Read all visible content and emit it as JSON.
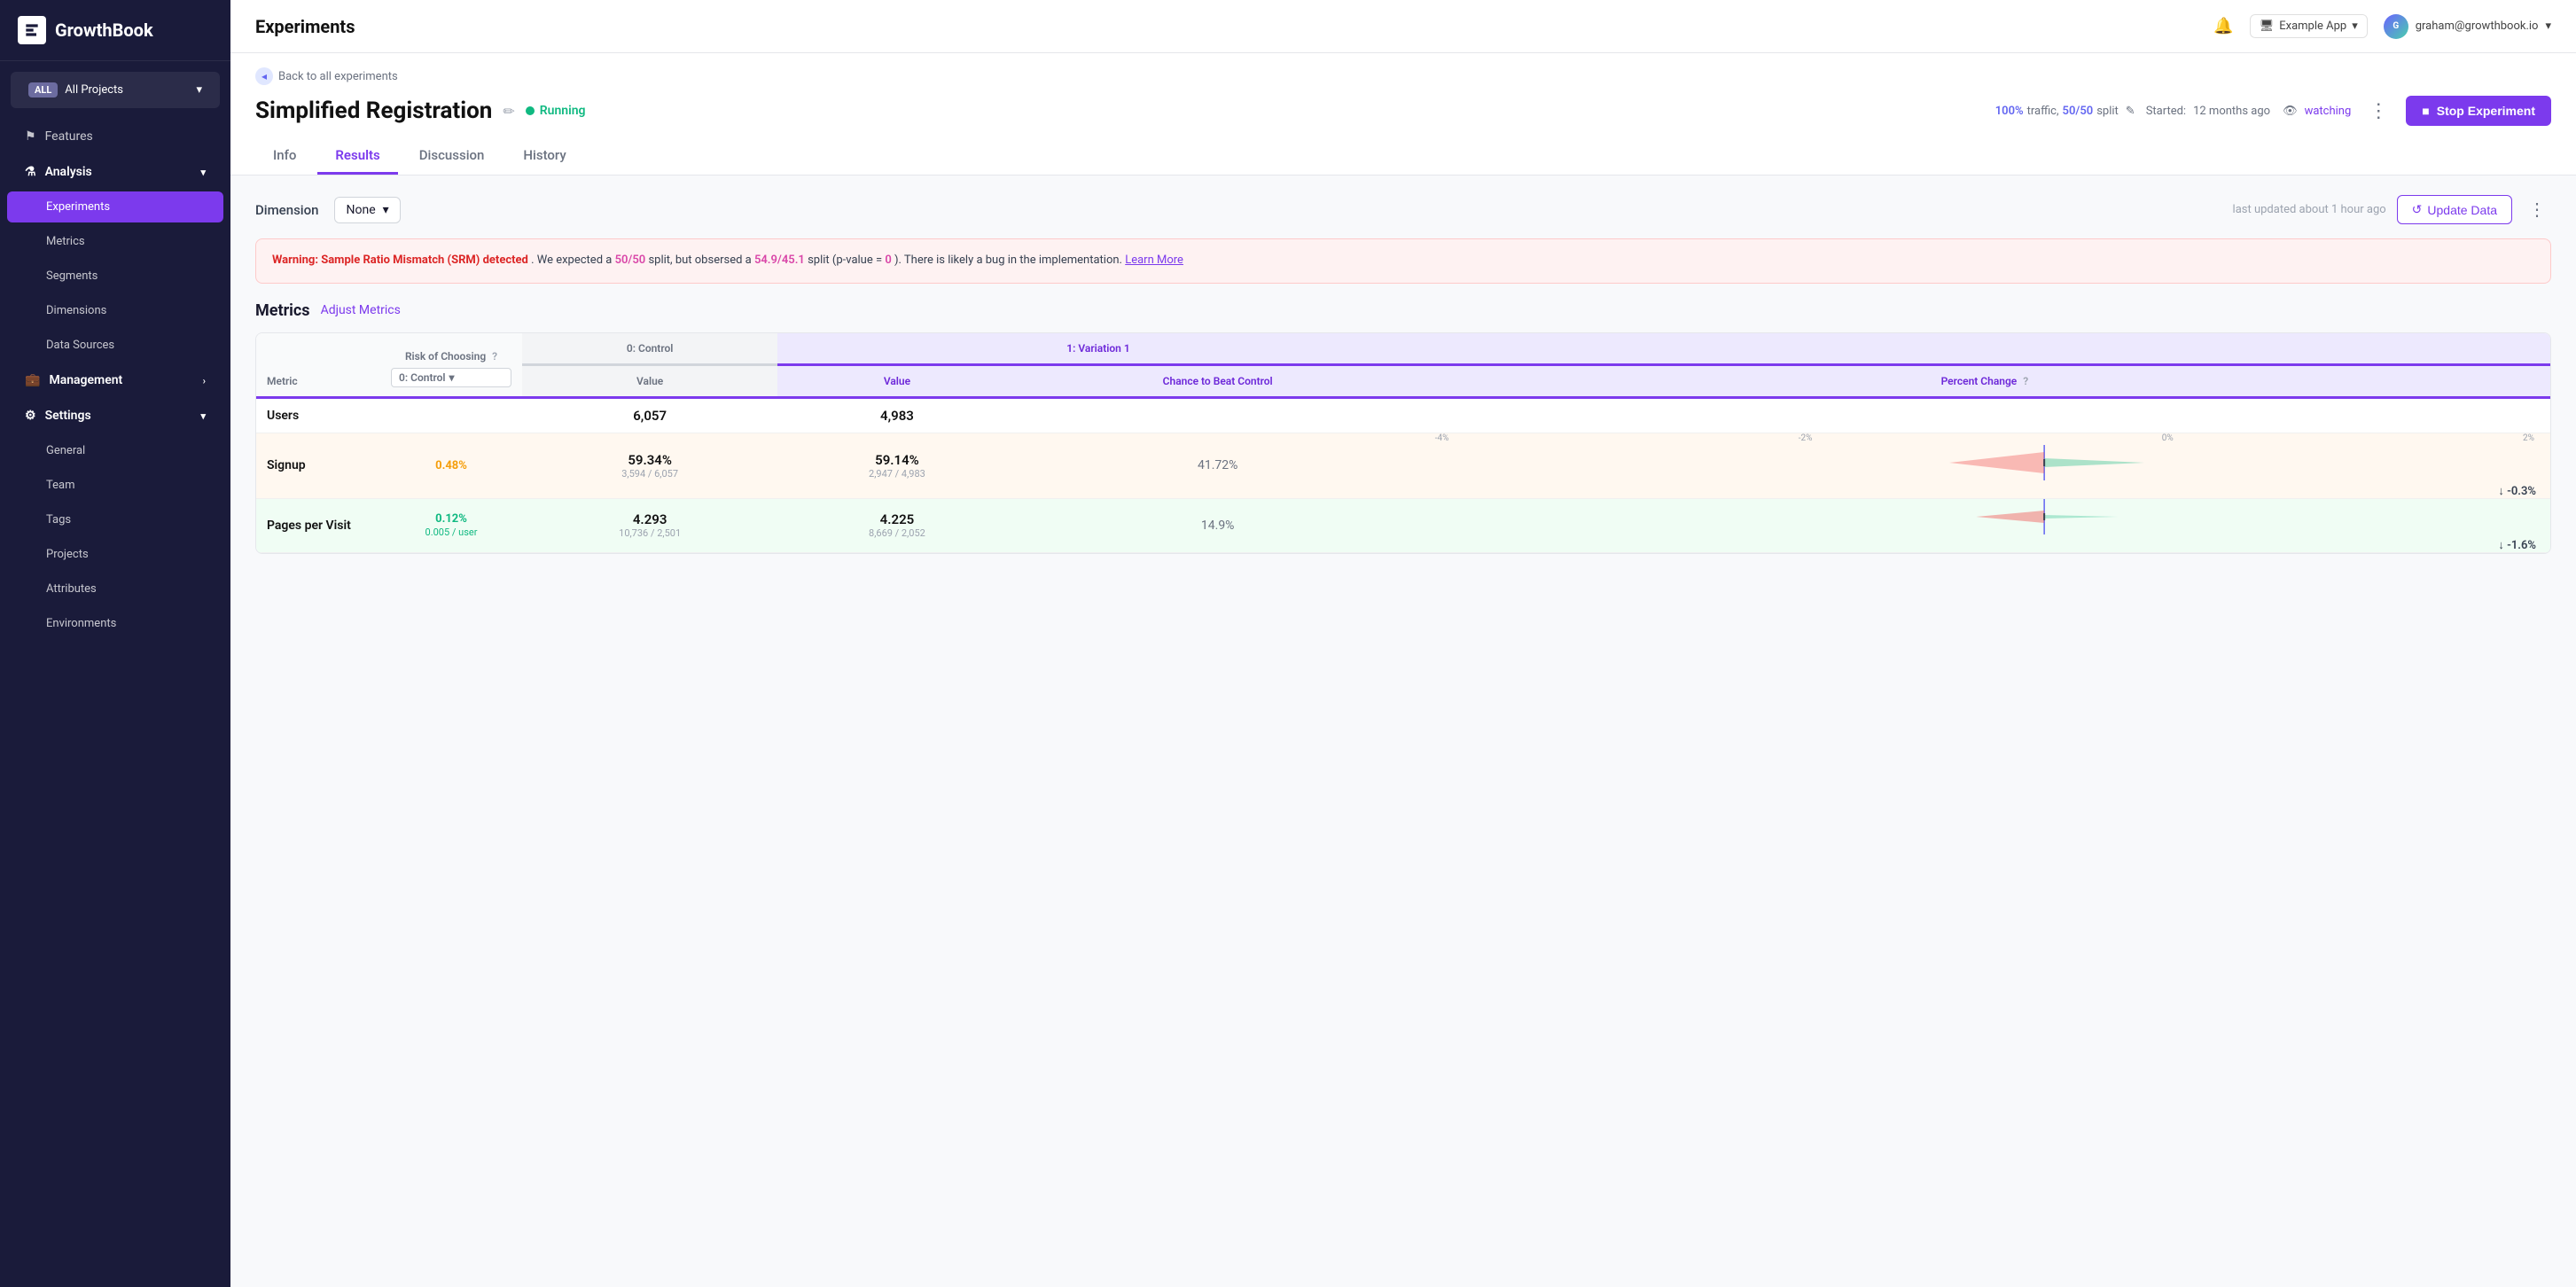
{
  "sidebar": {
    "logo": "GrowthBook",
    "projects": {
      "badge": "ALL",
      "label": "All Projects",
      "arrow": "▾"
    },
    "nav": [
      {
        "id": "features",
        "label": "Features",
        "icon": "flag",
        "active": false,
        "sub": false
      },
      {
        "id": "analysis",
        "label": "Analysis",
        "icon": "flask",
        "active": false,
        "sub": false,
        "hasArrow": true
      },
      {
        "id": "experiments",
        "label": "Experiments",
        "icon": "",
        "active": true,
        "sub": true
      },
      {
        "id": "metrics",
        "label": "Metrics",
        "icon": "",
        "active": false,
        "sub": true
      },
      {
        "id": "segments",
        "label": "Segments",
        "icon": "",
        "active": false,
        "sub": true
      },
      {
        "id": "dimensions",
        "label": "Dimensions",
        "icon": "",
        "active": false,
        "sub": true
      },
      {
        "id": "datasources",
        "label": "Data Sources",
        "icon": "",
        "active": false,
        "sub": true
      },
      {
        "id": "management",
        "label": "Management",
        "icon": "briefcase",
        "active": false,
        "sub": false,
        "hasArrow": true
      },
      {
        "id": "settings",
        "label": "Settings",
        "icon": "gear",
        "active": false,
        "sub": false,
        "hasArrow": true
      },
      {
        "id": "general",
        "label": "General",
        "icon": "",
        "active": false,
        "sub": true
      },
      {
        "id": "team",
        "label": "Team",
        "icon": "",
        "active": false,
        "sub": true
      },
      {
        "id": "tags",
        "label": "Tags",
        "icon": "",
        "active": false,
        "sub": true
      },
      {
        "id": "projects",
        "label": "Projects",
        "icon": "",
        "active": false,
        "sub": true
      },
      {
        "id": "attributes",
        "label": "Attributes",
        "icon": "",
        "active": false,
        "sub": true
      },
      {
        "id": "environments",
        "label": "Environments",
        "icon": "",
        "active": false,
        "sub": true
      }
    ]
  },
  "topbar": {
    "title": "Experiments",
    "app_label": "Example App",
    "user_email": "graham@growthbook.io",
    "user_initials": "G"
  },
  "experiment": {
    "back_label": "Back to all experiments",
    "title": "Simplified Registration",
    "status": "Running",
    "traffic_pct": "100%",
    "split": "50/50",
    "split_label": "split",
    "started_label": "Started:",
    "started_value": "12 months ago",
    "watching_label": "watching",
    "more_options": "⋮",
    "stop_btn": "Stop Experiment",
    "tabs": [
      {
        "id": "info",
        "label": "Info"
      },
      {
        "id": "results",
        "label": "Results",
        "active": true
      },
      {
        "id": "discussion",
        "label": "Discussion"
      },
      {
        "id": "history",
        "label": "History"
      }
    ]
  },
  "results": {
    "dimension_label": "Dimension",
    "dimension_value": "None",
    "last_updated": "last updated about 1 hour ago",
    "update_btn": "Update Data",
    "warning": {
      "bold": "Warning: Sample Ratio Mismatch (SRM) detected",
      "text": ". We expected a ",
      "split1": "50/50",
      "text2": " split, but obsersed a ",
      "split2": "54.9/45.1",
      "text3": " split (p-value = ",
      "pval": "0",
      "text4": "). There is likely a bug in the implementation.",
      "learn_more": "Learn More"
    },
    "metrics_title": "Metrics",
    "adjust_metrics": "Adjust Metrics",
    "table": {
      "col_metric": "Metric",
      "col_risk": "Risk of Choosing",
      "col_risk_dropdown": "0: Control",
      "col_control_header": "0: Control",
      "col_variation_header": "1: Variation 1",
      "col_control_value": "Value",
      "col_variation_value": "Value",
      "col_chance": "Chance to Beat Control",
      "col_pct_change": "Percent Change",
      "rows": [
        {
          "id": "users",
          "metric": "Users",
          "risk": "",
          "control_value": "6,057",
          "control_sub": "",
          "variation_value": "4,983",
          "variation_sub": "",
          "chance": "",
          "pct_change": "",
          "chart_type": "none"
        },
        {
          "id": "signup",
          "metric": "Signup",
          "risk": "0.48%",
          "risk_color": "yellow",
          "control_value": "59.34%",
          "control_sub": "3,594 / 6,057",
          "variation_value": "59.14%",
          "variation_sub": "2,947 / 4,983",
          "chance": "41.72%",
          "pct_change": "↓ -0.3%",
          "chart_type": "triangle"
        },
        {
          "id": "pages_per_visit",
          "metric": "Pages per Visit",
          "risk": "0.12%",
          "risk_color": "green",
          "risk_sub": "0.005 / user",
          "control_value": "4.293",
          "control_sub": "10,736 / 2,501",
          "variation_value": "4.225",
          "variation_sub": "8,669 / 2,052",
          "chance": "14.9%",
          "pct_change": "↓ -1.6%",
          "chart_type": "triangle"
        }
      ],
      "chart_ticks": [
        "-4%",
        "-2%",
        "0%",
        "2%"
      ]
    }
  }
}
